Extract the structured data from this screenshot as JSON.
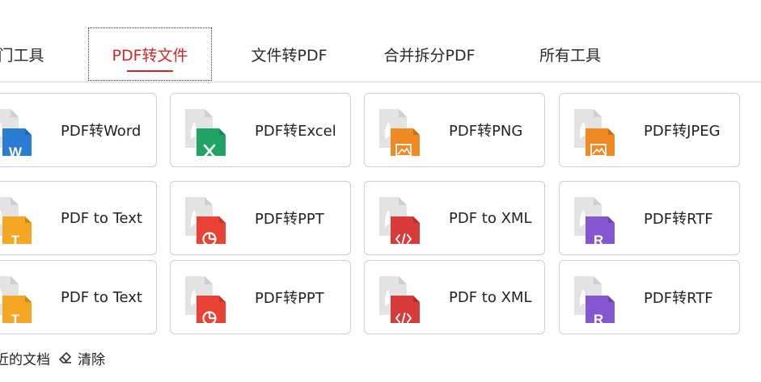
{
  "tabs": [
    {
      "label": "门工具"
    },
    {
      "label": "PDF转文件",
      "active": true
    },
    {
      "label": "文件转PDF"
    },
    {
      "label": "合并拆分PDF"
    },
    {
      "label": "所有工具"
    }
  ],
  "accent_color": "#cc2a2a",
  "cards": [
    {
      "label": "PDF转Word",
      "icon": "word-file-icon",
      "color": "#2b7cd3",
      "glyph": "W"
    },
    {
      "label": "PDF转Excel",
      "icon": "excel-file-icon",
      "color": "#21a366",
      "glyph": "X"
    },
    {
      "label": "PDF转PNG",
      "icon": "png-image-file-icon",
      "color": "#f08a24",
      "glyph": "img"
    },
    {
      "label": "PDF转JPEG",
      "icon": "jpeg-image-file-icon",
      "color": "#f08a24",
      "glyph": "img"
    },
    {
      "label": "PDF to Text",
      "icon": "text-file-icon",
      "color": "#f5a623",
      "glyph": "T"
    },
    {
      "label": "PDF转PPT",
      "icon": "ppt-file-icon",
      "color": "#ea4335",
      "glyph": "pie"
    },
    {
      "label": "PDF to XML",
      "icon": "xml-file-icon",
      "color": "#d93a3a",
      "glyph": "code"
    },
    {
      "label": "PDF转RTF",
      "icon": "rtf-file-icon",
      "color": "#8456cf",
      "glyph": "R"
    },
    {
      "label": "PDF to Text",
      "icon": "text-file-icon",
      "color": "#f5a623",
      "glyph": "T"
    },
    {
      "label": "PDF转PPT",
      "icon": "ppt-file-icon",
      "color": "#ea4335",
      "glyph": "pie"
    },
    {
      "label": "PDF to XML",
      "icon": "xml-file-icon",
      "color": "#d93a3a",
      "glyph": "code"
    },
    {
      "label": "PDF转RTF",
      "icon": "rtf-file-icon",
      "color": "#8456cf",
      "glyph": "R"
    }
  ],
  "footer": {
    "recent_label": "近的文档",
    "clear_label": "清除"
  }
}
